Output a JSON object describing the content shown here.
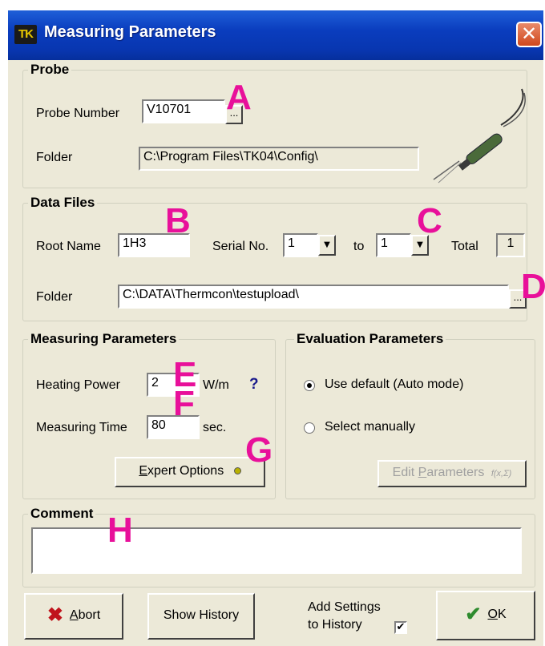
{
  "window": {
    "title": "Measuring Parameters",
    "app_icon_text": "TK",
    "close_symbol": "✕"
  },
  "probe": {
    "group_title": "Probe",
    "number_label": "Probe Number",
    "number_value": "V10701",
    "browse_label": "...",
    "folder_label": "Folder",
    "folder_value": "C:\\Program Files\\TK04\\Config\\"
  },
  "data_files": {
    "group_title": "Data Files",
    "root_name_label": "Root Name",
    "root_name_value": "1H3",
    "serial_label": "Serial No.",
    "serial_from": "1",
    "to_label": "to",
    "serial_to": "1",
    "total_label": "Total",
    "total_value": "1",
    "folder_label": "Folder",
    "folder_value": "C:\\DATA\\Thermcon\\testupload\\",
    "browse_label": "..."
  },
  "measuring": {
    "group_title": "Measuring Parameters",
    "heating_label": "Heating Power",
    "heating_value": "2",
    "heating_unit": "W/m",
    "help_symbol": "?",
    "time_label": "Measuring Time",
    "time_value": "80",
    "time_unit": "sec.",
    "expert_label_prefix": "",
    "expert_label_u": "E",
    "expert_label_rest": "xpert Options"
  },
  "evaluation": {
    "group_title": "Evaluation Parameters",
    "option_default": "Use default (Auto mode)",
    "option_manual": "Select manually",
    "selected": "default",
    "edit_prefix": "Edit ",
    "edit_u": "P",
    "edit_rest": "arameters",
    "edit_icon_text": "f(x,Σ)"
  },
  "comment": {
    "group_title": "Comment",
    "value": ""
  },
  "footer": {
    "abort_u": "A",
    "abort_rest": "bort",
    "show_history": "Show History",
    "add_settings_line1": "Add Settings",
    "add_settings_line2": "to History",
    "add_settings_checked": true,
    "check_mark": "✔",
    "ok_u": "O",
    "ok_rest": "K"
  },
  "annotations": [
    "A",
    "B",
    "C",
    "D",
    "E",
    "F",
    "G",
    "H"
  ],
  "colors": {
    "annotation": "#e8109a",
    "titlebar": "#0a3dbe",
    "dialog_bg": "#ece9d8",
    "abort_x": "#c0141c",
    "ok_check": "#2e8b2e",
    "help": "#1a1a8c"
  }
}
